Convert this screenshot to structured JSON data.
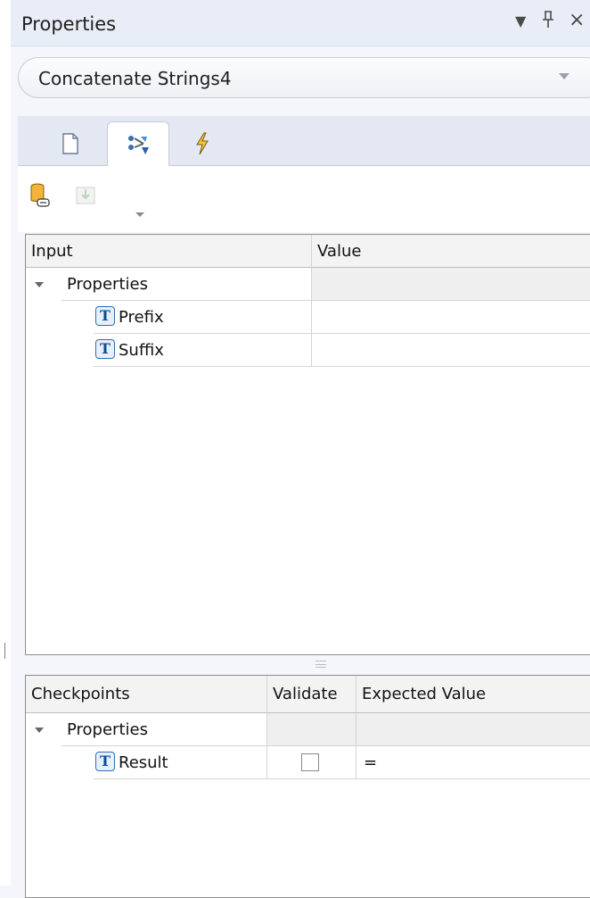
{
  "header": {
    "title": "Properties",
    "dropdown_glyph": "▼",
    "pin_glyph": "ᛣ",
    "close_glyph": "×"
  },
  "selector": {
    "value": "Concatenate Strings4"
  },
  "tabs": [
    {
      "name": "general",
      "icon": "document-icon"
    },
    {
      "name": "input-output",
      "icon": "data-mapping-icon",
      "active": true
    },
    {
      "name": "events",
      "icon": "lightning-icon"
    }
  ],
  "toolbar": {
    "buttons": [
      "database-link-icon",
      "import-icon"
    ]
  },
  "input_grid": {
    "columns": [
      "Input",
      "Value"
    ],
    "group": "Properties",
    "rows": [
      {
        "name": "Prefix",
        "value": ""
      },
      {
        "name": "Suffix",
        "value": ""
      }
    ]
  },
  "checkpoint_grid": {
    "columns": [
      "Checkpoints",
      "Validate",
      "Expected Value"
    ],
    "group": "Properties",
    "rows": [
      {
        "name": "Result",
        "validate": false,
        "expected": "="
      }
    ]
  },
  "icon_letter": "T",
  "colors": {
    "header_bg": "#e9edf7",
    "icon_blue": "#2f6db5",
    "grid_border": "#8e8e8e"
  }
}
